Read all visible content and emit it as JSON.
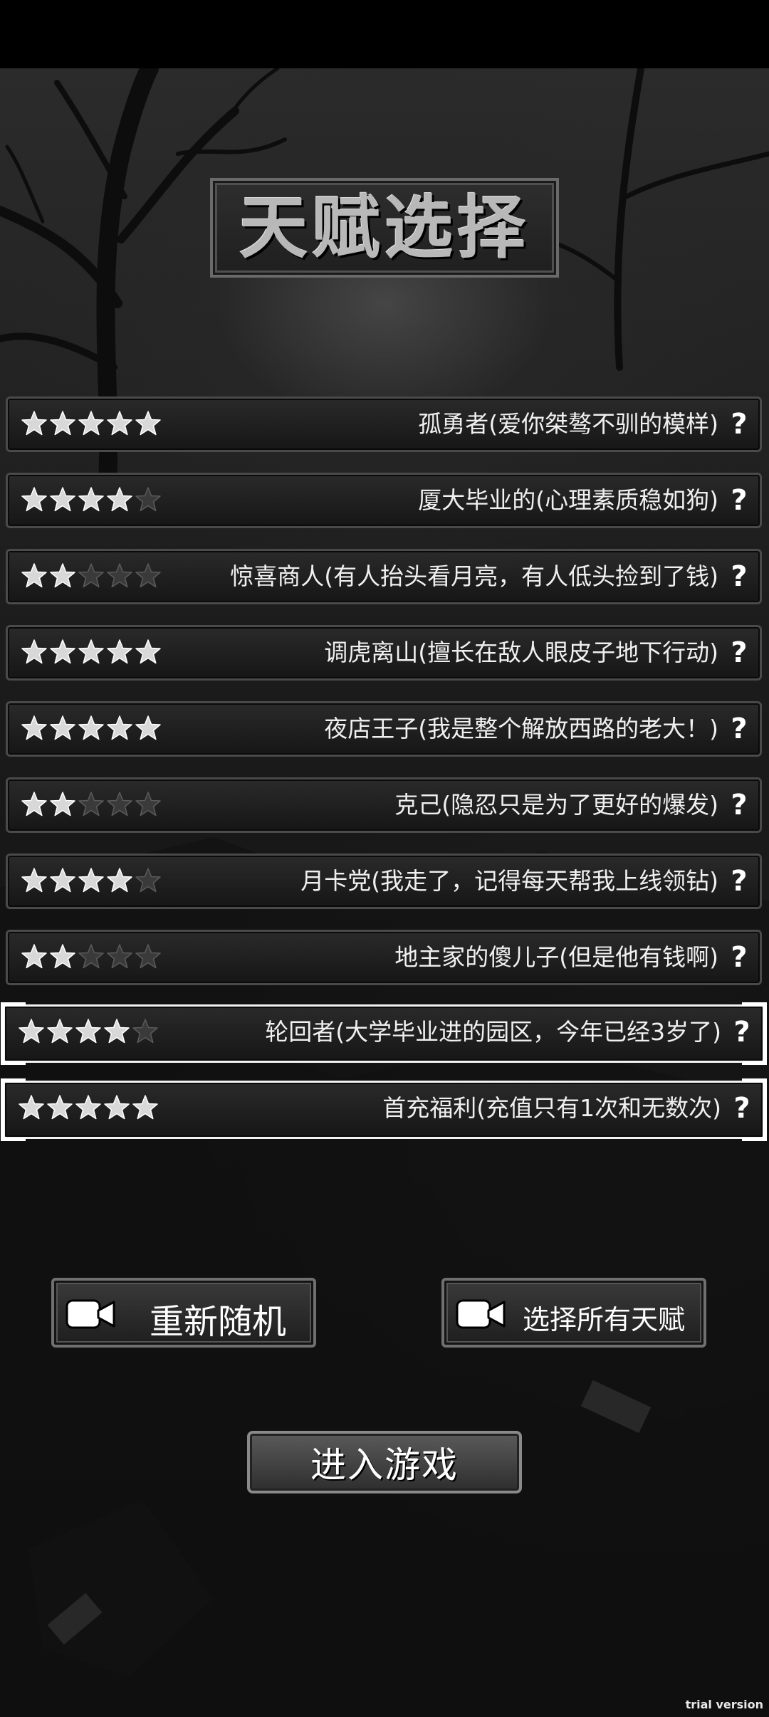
{
  "title": "天赋选择",
  "talents": [
    {
      "label": "孤勇者(爱你桀骜不驯的模样)",
      "rating": 5,
      "max_rating": 5,
      "selected": false,
      "icon": "help-icon"
    },
    {
      "label": "厦大毕业的(心理素质稳如狗)",
      "rating": 4,
      "max_rating": 5,
      "selected": false,
      "icon": "help-icon"
    },
    {
      "label": "惊喜商人(有人抬头看月亮，有人低头捡到了钱)",
      "rating": 2,
      "max_rating": 5,
      "selected": false,
      "icon": "help-icon"
    },
    {
      "label": "调虎离山(擅长在敌人眼皮子地下行动)",
      "rating": 5,
      "max_rating": 5,
      "selected": false,
      "icon": "help-icon"
    },
    {
      "label": "夜店王子(我是整个解放西路的老大！)",
      "rating": 5,
      "max_rating": 5,
      "selected": false,
      "icon": "help-icon"
    },
    {
      "label": "克己(隐忍只是为了更好的爆发)",
      "rating": 2,
      "max_rating": 5,
      "selected": false,
      "icon": "help-icon"
    },
    {
      "label": "月卡党(我走了，记得每天帮我上线领钻)",
      "rating": 4,
      "max_rating": 5,
      "selected": false,
      "icon": "help-icon"
    },
    {
      "label": "地主家的傻儿子(但是他有钱啊)",
      "rating": 2,
      "max_rating": 5,
      "selected": false,
      "icon": "help-icon"
    },
    {
      "label": "轮回者(大学毕业进的园区，今年已经3岁了)",
      "rating": 4,
      "max_rating": 5,
      "selected": true,
      "icon": "help-icon"
    },
    {
      "label": "首充福利(充值只有1次和无数次)",
      "rating": 5,
      "max_rating": 5,
      "selected": true,
      "icon": "help-icon"
    }
  ],
  "help_glyph": "?",
  "buttons": {
    "reroll": {
      "label": "重新随机",
      "icon": "video-camera-icon"
    },
    "select_all": {
      "label": "选择所有天赋",
      "icon": "video-camera-icon"
    },
    "start": {
      "label": "进入游戏"
    }
  },
  "watermark": "trial version",
  "colors": {
    "star_filled": "#d8d8d8",
    "star_empty": "#3a3a3a",
    "selected_border": "#ffffff"
  }
}
